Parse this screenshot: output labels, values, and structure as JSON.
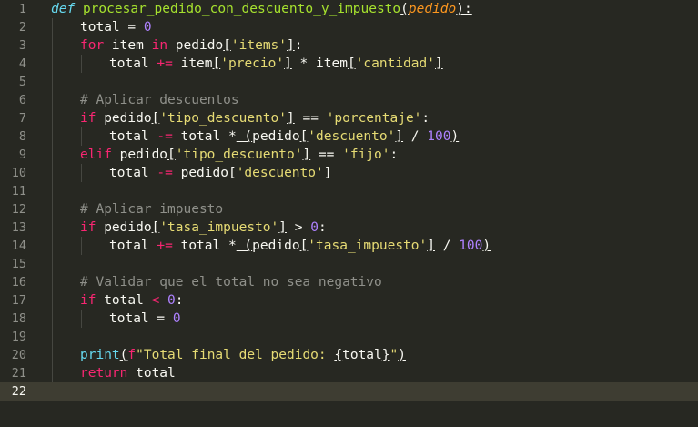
{
  "editor": {
    "active_line": 22,
    "colors": {
      "background": "#272822",
      "current_line": "#3e3d32",
      "keyword": "#f92672",
      "function": "#a6e22e",
      "builtin": "#66d9ef",
      "number": "#ae81ff",
      "string": "#e6db74",
      "comment": "#8f908a",
      "text": "#f8f8f2"
    },
    "lines": [
      {
        "n": "1"
      },
      {
        "n": "2"
      },
      {
        "n": "3"
      },
      {
        "n": "4"
      },
      {
        "n": "5"
      },
      {
        "n": "6"
      },
      {
        "n": "7"
      },
      {
        "n": "8"
      },
      {
        "n": "9"
      },
      {
        "n": "10"
      },
      {
        "n": "11"
      },
      {
        "n": "12"
      },
      {
        "n": "13"
      },
      {
        "n": "14"
      },
      {
        "n": "15"
      },
      {
        "n": "16"
      },
      {
        "n": "17"
      },
      {
        "n": "18"
      },
      {
        "n": "19"
      },
      {
        "n": "20"
      },
      {
        "n": "21"
      },
      {
        "n": "22"
      }
    ],
    "code": {
      "l1": {
        "def": "def",
        "name": "procesar_pedido_con_descuento_y_impuesto",
        "open": "(",
        "param": "pedido",
        "close": "):"
      },
      "l2": {
        "a": "total = ",
        "num": "0"
      },
      "l3": {
        "for": "for",
        "a": " item ",
        "in": "in",
        "b": " pedido",
        "o": "[",
        "s": "'items'",
        "c": "]",
        ":": ":"
      },
      "l4": {
        "a": "total ",
        "op": "+=",
        "b": " item",
        "o1": "[",
        "s1": "'precio'",
        "c1": "]",
        "op2": " * ",
        "d": "item",
        "o2": "[",
        "s2": "'cantidad'",
        "c2": "]"
      },
      "l6": {
        "cm": "# Aplicar descuentos"
      },
      "l7": {
        "if": "if",
        "a": " pedido",
        "o": "[",
        "s1": "'tipo_descuento'",
        "c": "]",
        "op": " == ",
        "s2": "'porcentaje'",
        ":": ":"
      },
      "l8": {
        "a": "total ",
        "op": "-=",
        "b": " total ",
        "op2": "*",
        "p1": " (",
        "d": "pedido",
        "o": "[",
        "s": "'descuento'",
        "c": "]",
        "op3": " / ",
        "num": "100",
        "p2": ")"
      },
      "l9": {
        "elif": "elif",
        "a": " pedido",
        "o": "[",
        "s1": "'tipo_descuento'",
        "c": "]",
        "op": " == ",
        "s2": "'fijo'",
        ":": ":"
      },
      "l10": {
        "a": "total ",
        "op": "-=",
        "b": " pedido",
        "o": "[",
        "s": "'descuento'",
        "c": "]"
      },
      "l12": {
        "cm": "# Aplicar impuesto"
      },
      "l13": {
        "if": "if",
        "a": " pedido",
        "o": "[",
        "s": "'tasa_impuesto'",
        "c": "]",
        "op": " > ",
        "num": "0",
        ":": ":"
      },
      "l14": {
        "a": "total ",
        "op": "+=",
        "b": " total ",
        "op2": "*",
        "p1": " (",
        "d": "pedido",
        "o": "[",
        "s": "'tasa_impuesto'",
        "c": "]",
        "op3": " / ",
        "num": "100",
        "p2": ")"
      },
      "l16": {
        "cm": "# Validar que el total no sea negativo"
      },
      "l17": {
        "if": "if",
        "a": " total ",
        "op": "<",
        "sp": " ",
        "num": "0",
        ":": ":"
      },
      "l18": {
        "a": "total = ",
        "num": "0"
      },
      "l20": {
        "fn": "print",
        "o": "(",
        "f": "f",
        "s1": "\"Total final del pedido: ",
        "b1": "{",
        "v": "total",
        "b2": "}",
        "s2": "\"",
        "c": ")"
      },
      "l21": {
        "ret": "return",
        "a": " total"
      }
    }
  }
}
